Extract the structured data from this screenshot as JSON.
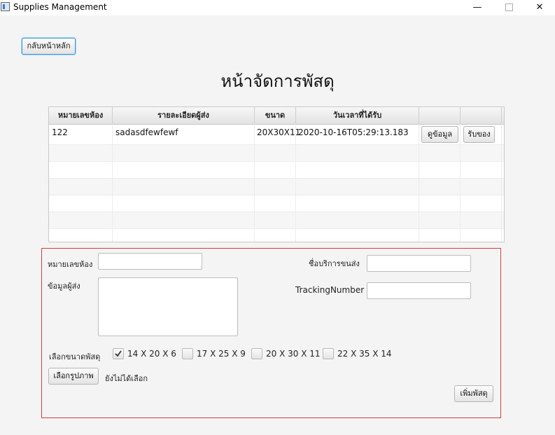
{
  "window": {
    "title": "Supplies Management",
    "min_glyph": "—",
    "close_glyph": "✕"
  },
  "back_button": "กลับหน้าหลัก",
  "page_title": "หน้าจัดการพัสดุ",
  "table": {
    "headers": [
      "หมายเลขห้อง",
      "รายละเอียดผู้ส่ง",
      "ขนาด",
      "วันเวลาที่ได้รับ",
      "",
      ""
    ],
    "rows": [
      {
        "room": "122",
        "sender": "sadasdfewfewf",
        "size": "20X30X11",
        "received": "2020-10-16T05:29:13.183",
        "view_label": "ดูข้อมูล",
        "receive_label": "รับของ"
      }
    ]
  },
  "form": {
    "room_label": "หมายเลขห้อง",
    "room_value": "",
    "sender_label": "ข้อมูลผู้ส่ง",
    "sender_value": "",
    "carrier_label": "ชื่อบริการขนส่ง",
    "carrier_value": "",
    "tracking_label": "TrackingNumber",
    "tracking_value": "",
    "size_label": "เลือกขนาดพัสดุ",
    "sizes": [
      {
        "label": "14 X 20 X 6",
        "checked": true
      },
      {
        "label": "17 X 25 X 9",
        "checked": false
      },
      {
        "label": "20 X 30 X 11",
        "checked": false
      },
      {
        "label": "22 X 35 X 14",
        "checked": false
      }
    ],
    "choose_image_label": "เลือกรูปภาพ",
    "image_status": "ยังไม่ได้เลือก",
    "add_button": "เพิ่มพัสดุ"
  },
  "colors": {
    "form_border": "#d04040",
    "focus_blue": "#3d9ad8"
  }
}
